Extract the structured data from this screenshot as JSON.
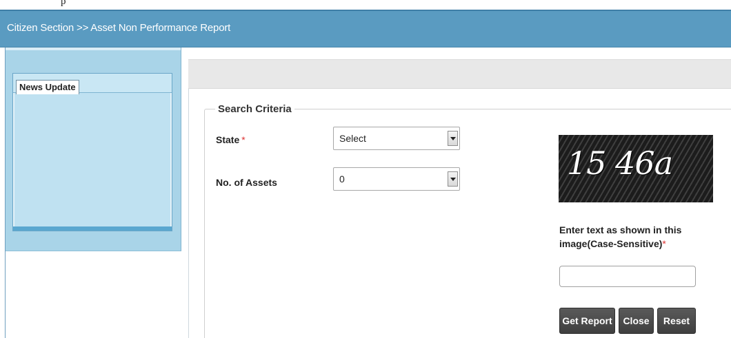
{
  "top_strip_text": "p",
  "breadcrumb": "Citizen Section >> Asset Non Performance Report",
  "news": {
    "tab_label": "News Update"
  },
  "search": {
    "legend": "Search Criteria",
    "state_label": "State",
    "state_required": "*",
    "state_value": "Select",
    "assets_label": "No. of Assets",
    "assets_value": "0"
  },
  "captcha": {
    "text": "15 46a",
    "instruction": "Enter text as shown in this image(Case-Sensitive)",
    "required": "*",
    "input_value": ""
  },
  "buttons": {
    "get_report": "Get Report",
    "close": "Close",
    "reset": "Reset"
  },
  "icons": {
    "dropdown": "chevron-down-icon"
  },
  "colors": {
    "header": "#5a9bc1",
    "sidebar": "#a9d4e8",
    "button": "#4a4a4a",
    "required": "#d33333"
  }
}
